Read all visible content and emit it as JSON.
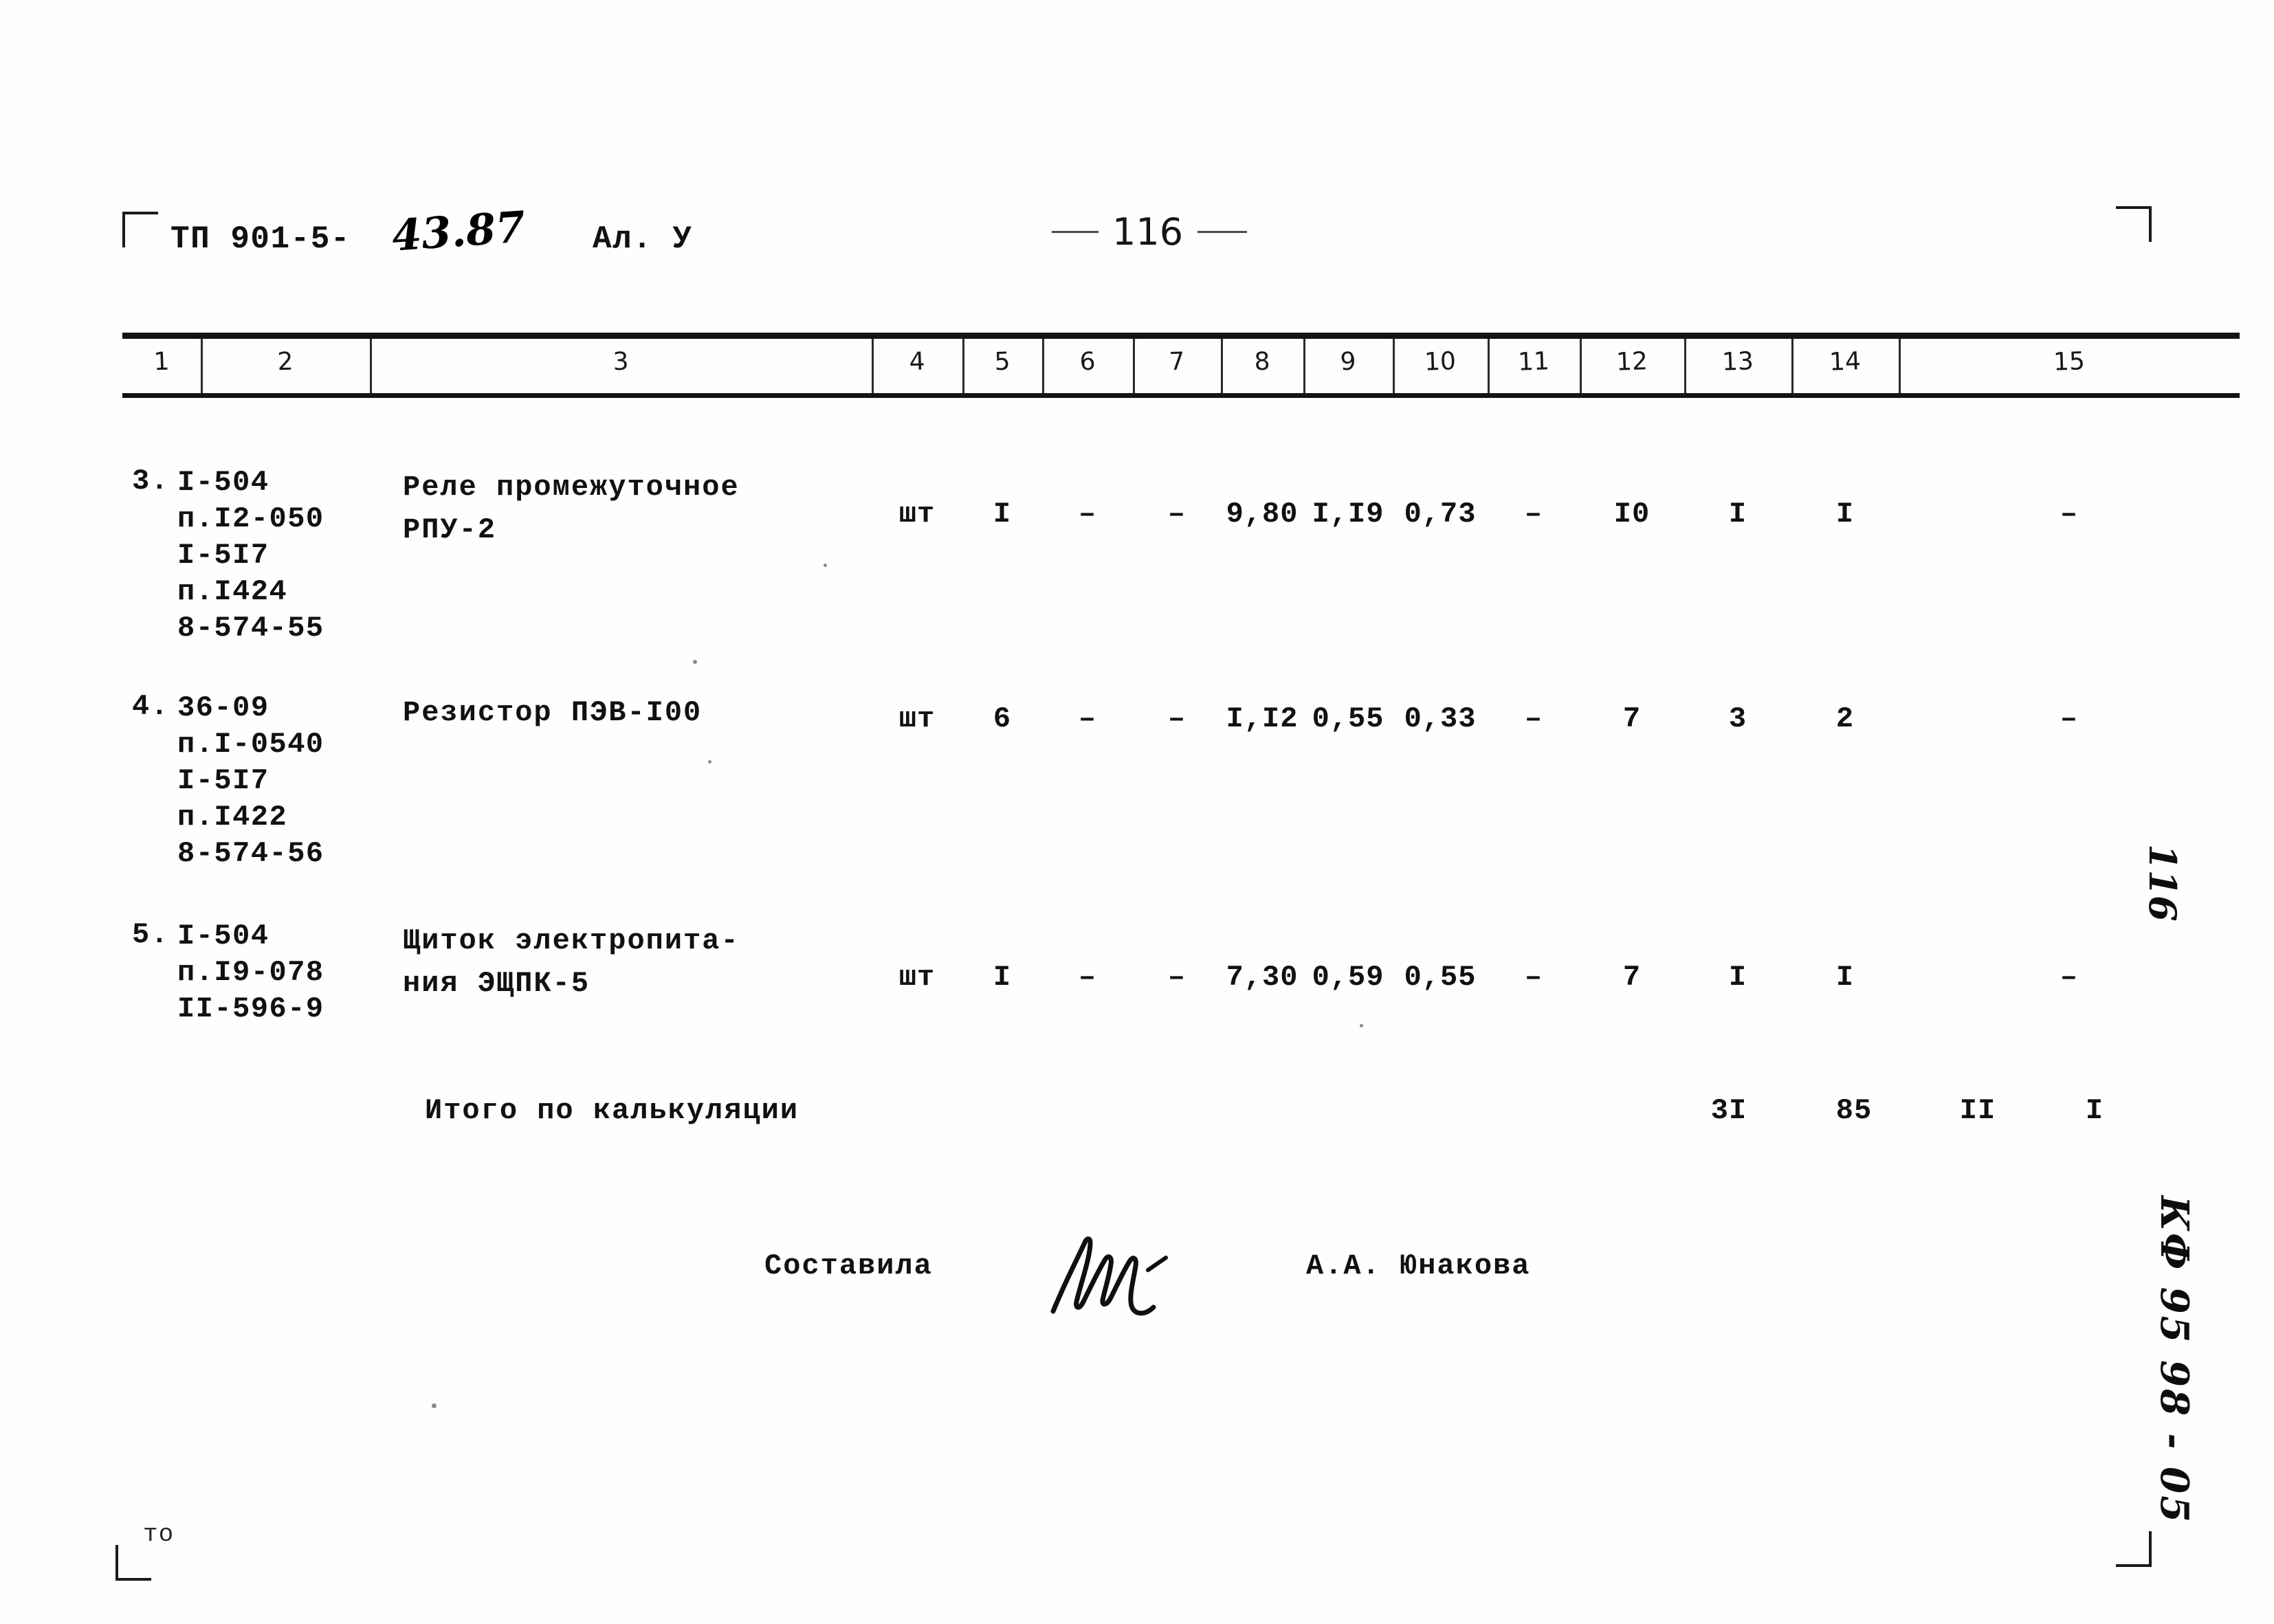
{
  "document": {
    "code_typed": "ТП 901-5-",
    "code_handwritten": "43.87",
    "album": "Ал. У",
    "page_number_top": "116",
    "bottom_stray_text": "то"
  },
  "margin_notes": {
    "page_number": "116",
    "archive_code": "КФ 95 98 - 05"
  },
  "table": {
    "column_headers": [
      "1",
      "2",
      "3",
      "4",
      "5",
      "6",
      "7",
      "8",
      "9",
      "10",
      "11",
      "12",
      "13",
      "14",
      "15"
    ],
    "rows": [
      {
        "index": "3.",
        "codes": "I-504\nп.I2-050\nI-5I7\nп.I424\n8-574-55",
        "name": "Реле промежуточное\nРПУ-2",
        "unit": "шт",
        "c5": "I",
        "c6": "–",
        "c7": "–",
        "c8": "9,80",
        "c9": "I,I9",
        "c10": "0,73",
        "c11": "–",
        "c12": "I0",
        "c13": "I",
        "c14": "I",
        "c15": "–"
      },
      {
        "index": "4.",
        "codes": "36-09\nп.I-0540\nI-5I7\nп.I422\n8-574-56",
        "name": "Резистор ПЭВ-I00",
        "unit": "шт",
        "c5": "6",
        "c6": "–",
        "c7": "–",
        "c8": "I,I2",
        "c9": "0,55",
        "c10": "0,33",
        "c11": "–",
        "c12": "7",
        "c13": "3",
        "c14": "2",
        "c15": "–"
      },
      {
        "index": "5.",
        "codes": "I-504\nп.I9-078\nII-596-9",
        "name": "Щиток электропита-\nния ЭЩПК-5",
        "unit": "шт",
        "c5": "I",
        "c6": "–",
        "c7": "–",
        "c8": "7,30",
        "c9": "0,59",
        "c10": "0,55",
        "c11": "–",
        "c12": "7",
        "c13": "I",
        "c14": "I",
        "c15": "–"
      }
    ],
    "totals": {
      "label": "Итого по калькуляции",
      "c12": "3I",
      "c13": "85",
      "c14": "II",
      "c15": "I"
    }
  },
  "signature": {
    "label": "Составила",
    "name": "А.А. Юнакова"
  }
}
